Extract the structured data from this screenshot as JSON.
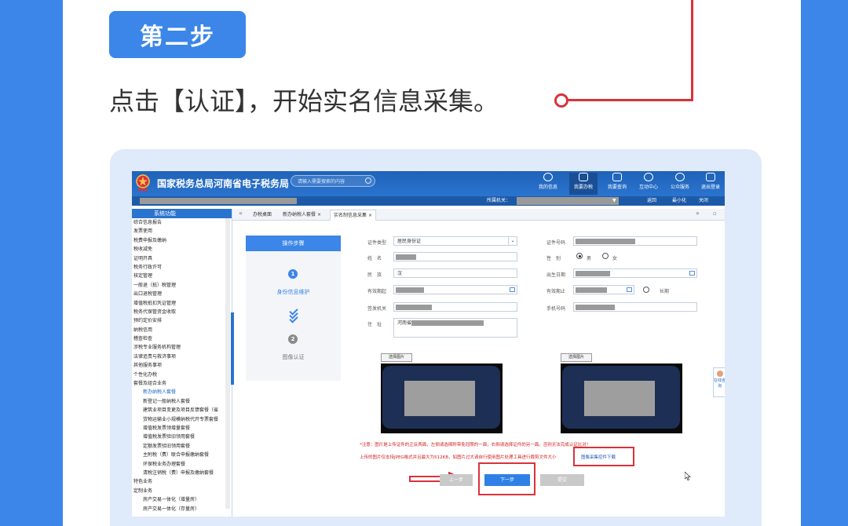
{
  "header": {
    "step_badge": "第二步",
    "instruction": "点击【认证】，开始实名信息采集。"
  },
  "app": {
    "brand": "国家税务总局河南省电子税务局",
    "search_placeholder": "请输入需要搜索的内容",
    "nav": [
      {
        "label": "我的信息",
        "icon": "user-icon"
      },
      {
        "label": "我要办税",
        "icon": "monitor-icon"
      },
      {
        "label": "我要查询",
        "icon": "query-icon"
      },
      {
        "label": "互动中心",
        "icon": "chat-icon"
      },
      {
        "label": "公众服务",
        "icon": "service-icon"
      },
      {
        "label": "退出登录",
        "icon": "logout-icon"
      }
    ],
    "subbar": {
      "org_label": "所属机关：",
      "back": "返回",
      "minimize": "最小化",
      "close": "关闭"
    }
  },
  "sidebar": {
    "title": "系统功能",
    "items": [
      {
        "label": "综合信息报告",
        "level": 0
      },
      {
        "label": "发票使用",
        "level": 0
      },
      {
        "label": "税费申报及缴纳",
        "level": 0
      },
      {
        "label": "税收减免",
        "level": 0
      },
      {
        "label": "证明开具",
        "level": 0
      },
      {
        "label": "税务行政许可",
        "level": 0
      },
      {
        "label": "核定管理",
        "level": 0
      },
      {
        "label": "一般退（抵）税管理",
        "level": 0
      },
      {
        "label": "出口退税管理",
        "level": 0
      },
      {
        "label": "增值税抵扣凭证管理",
        "level": 0
      },
      {
        "label": "税务代保管资金收取",
        "level": 0
      },
      {
        "label": "预约定价安排",
        "level": 0
      },
      {
        "label": "纳税信用",
        "level": 0
      },
      {
        "label": "稽查检查",
        "level": 0
      },
      {
        "label": "涉税专业服务机构管理",
        "level": 0
      },
      {
        "label": "法律追责与救济事项",
        "level": 0
      },
      {
        "label": "其他服务事项",
        "level": 0
      },
      {
        "label": "个性化办税",
        "level": 0
      },
      {
        "label": "套餐及组合业务",
        "level": 0
      },
      {
        "label": "新办纳税人套餐",
        "level": 1,
        "active": true
      },
      {
        "label": "新登记一般纳税人套餐",
        "level": 1
      },
      {
        "label": "建筑业项目变更及项目反馈套餐（省",
        "level": 1
      },
      {
        "label": "货物运输业小规模纳税代开专票套餐",
        "level": 1
      },
      {
        "label": "增值税发票领增量套餐",
        "level": 1
      },
      {
        "label": "增值税发票验旧领用套餐",
        "level": 1
      },
      {
        "label": "定额发票验旧领用套餐",
        "level": 1
      },
      {
        "label": "主附税（费）联合申报缴纳套餐",
        "level": 1
      },
      {
        "label": "环保税业务办理套餐",
        "level": 1
      },
      {
        "label": "清税注销税（费）申报及缴纳套餐",
        "level": 1
      },
      {
        "label": "特色业务",
        "level": 0
      },
      {
        "label": "定制业务",
        "level": 0
      },
      {
        "label": "房产交易一体化（增量房）",
        "level": 1
      },
      {
        "label": "房产交易一体化（存量房）",
        "level": 1
      }
    ]
  },
  "tabs": [
    {
      "label": "办税桌面"
    },
    {
      "label": "新办纳税人套餐",
      "closable": true
    },
    {
      "label": "实名制信息采集",
      "closable": true,
      "active": true
    }
  ],
  "steps": {
    "header": "操作步骤",
    "items": [
      {
        "num": "1",
        "label": "身份信息维护",
        "active": true
      },
      {
        "num": "2",
        "label": "图像认证",
        "active": false
      }
    ]
  },
  "form": {
    "id_type_label": "证件类型",
    "id_type_value": "居民身份证",
    "id_number_label": "证件号码",
    "name_label": "姓　名",
    "gender_label": "性　别",
    "gender_male": "男",
    "gender_female": "女",
    "ethnicity_label": "民　族",
    "ethnicity_value": "汉",
    "birth_label": "出生日期",
    "valid_from_label": "有效期起",
    "valid_to_label": "有效期止",
    "long_term_label": "长期",
    "issuer_label": "签发机关",
    "phone_label": "手机号码",
    "address_label": "住　址",
    "address_value": "河南省"
  },
  "photos": {
    "select_label": "选择图片"
  },
  "notice": {
    "line1": "*注意：图片是上传证件的正反两面，左侧请选择附带免冠照的一面，右侧请选择证件的另一面。否则无法完成认证比对！",
    "line2": "上传的图片仅支持JPEG格式并且最大为512KB，如图片过大请自行使用图片处理工具进行裁剪文件大小",
    "download_link": "图像采集控件下载"
  },
  "buttons": {
    "prev": "上一步",
    "next": "下一步",
    "submit": "提交"
  },
  "side_tool": {
    "label": "在线咨询"
  },
  "colors": {
    "page_blue": "#3b86e8",
    "highlight_red": "#d9323b",
    "app_header": "#2a74cf"
  }
}
